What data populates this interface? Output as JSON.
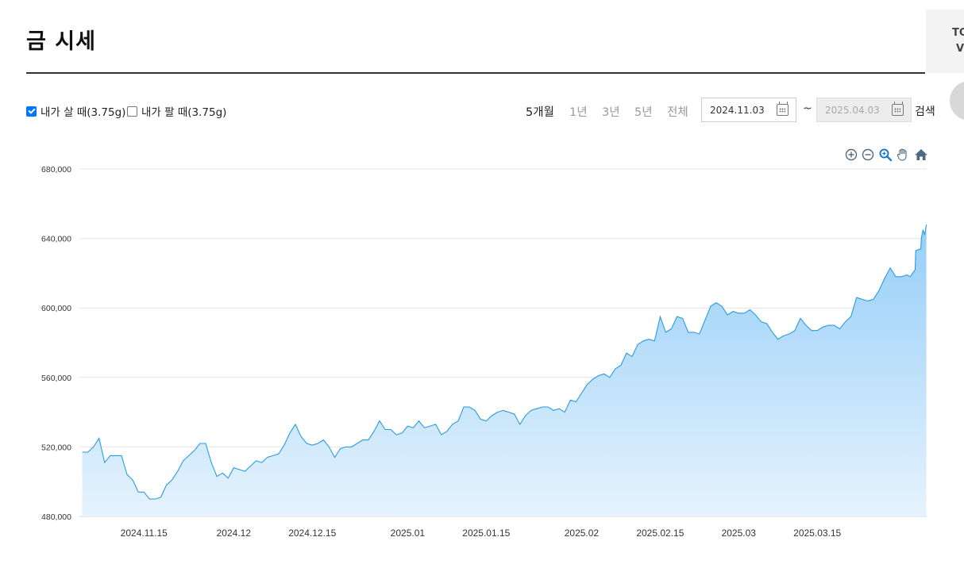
{
  "page": {
    "title": "금 시세",
    "side_box": [
      "TO",
      "V"
    ]
  },
  "filters": {
    "buy": {
      "label": "내가 살 때(3.75g)",
      "checked": true
    },
    "sell": {
      "label": "내가 팔 때(3.75g)",
      "checked": false
    }
  },
  "periods": [
    "5개월",
    "1년",
    "3년",
    "5년",
    "전체"
  ],
  "active_period": "5개월",
  "date_range": {
    "start": "2024.11.03",
    "end": "2025.04.03",
    "separator": "~"
  },
  "search_label": "검색",
  "toolbar": [
    "zoom-in-icon",
    "zoom-out-icon",
    "magnify-icon",
    "pan-hand-icon",
    "home-icon"
  ],
  "colors": {
    "line": "#2b9be0",
    "fill_top": "#95cef8",
    "fill_bottom": "#e6f3fd",
    "checkbox": "#0075ff"
  },
  "chart_data": {
    "type": "area",
    "x_labels": [
      "2024.11.15",
      "2024.12",
      "2024.12.15",
      "2025.01",
      "2025.01.15",
      "2025.02",
      "2025.02.15",
      "2025.03",
      "2025.03.15"
    ],
    "y_ticks": [
      "680,000",
      "640,000",
      "600,000",
      "560,000",
      "520,000",
      "480,000"
    ],
    "ylim": [
      480000,
      680000
    ],
    "xlim": [
      "2024-11-04",
      "2025-04-03"
    ],
    "grid": true,
    "series": [
      {
        "values": [
          [
            "2024-11-04",
            517000
          ],
          [
            "2024-11-05",
            517000
          ],
          [
            "2024-11-06",
            520000
          ],
          [
            "2024-11-07",
            525000
          ],
          [
            "2024-11-08",
            511000
          ],
          [
            "2024-11-09",
            515000
          ],
          [
            "2024-11-10",
            515000
          ],
          [
            "2024-11-11",
            515000
          ],
          [
            "2024-11-12",
            504000
          ],
          [
            "2024-11-13",
            501000
          ],
          [
            "2024-11-14",
            494000
          ],
          [
            "2024-11-15",
            494000
          ],
          [
            "2024-11-16",
            490000
          ],
          [
            "2024-11-17",
            490000
          ],
          [
            "2024-11-18",
            491000
          ],
          [
            "2024-11-19",
            498000
          ],
          [
            "2024-11-20",
            501000
          ],
          [
            "2024-11-21",
            506000
          ],
          [
            "2024-11-22",
            512000
          ],
          [
            "2024-11-23",
            515000
          ],
          [
            "2024-11-24",
            518000
          ],
          [
            "2024-11-25",
            522000
          ],
          [
            "2024-11-26",
            522000
          ],
          [
            "2024-11-27",
            511000
          ],
          [
            "2024-11-28",
            503000
          ],
          [
            "2024-11-29",
            505000
          ],
          [
            "2024-11-30",
            502000
          ],
          [
            "2024-12-01",
            508000
          ],
          [
            "2024-12-02",
            507000
          ],
          [
            "2024-12-03",
            506000
          ],
          [
            "2024-12-04",
            509000
          ],
          [
            "2024-12-05",
            512000
          ],
          [
            "2024-12-06",
            511000
          ],
          [
            "2024-12-07",
            514000
          ],
          [
            "2024-12-08",
            515000
          ],
          [
            "2024-12-09",
            516000
          ],
          [
            "2024-12-10",
            521000
          ],
          [
            "2024-12-11",
            528000
          ],
          [
            "2024-12-12",
            533000
          ],
          [
            "2024-12-13",
            526000
          ],
          [
            "2024-12-14",
            522000
          ],
          [
            "2024-12-15",
            521000
          ],
          [
            "2024-12-16",
            522000
          ],
          [
            "2024-12-17",
            524000
          ],
          [
            "2024-12-18",
            520000
          ],
          [
            "2024-12-19",
            514000
          ],
          [
            "2024-12-20",
            519000
          ],
          [
            "2024-12-21",
            520000
          ],
          [
            "2024-12-22",
            520000
          ],
          [
            "2024-12-23",
            522000
          ],
          [
            "2024-12-24",
            524000
          ],
          [
            "2024-12-25",
            524000
          ],
          [
            "2024-12-26",
            529000
          ],
          [
            "2024-12-27",
            535000
          ],
          [
            "2024-12-28",
            530000
          ],
          [
            "2024-12-29",
            530000
          ],
          [
            "2024-12-30",
            527000
          ],
          [
            "2024-12-31",
            528000
          ],
          [
            "2025-01-01",
            532000
          ],
          [
            "2025-01-02",
            531000
          ],
          [
            "2025-01-03",
            535000
          ],
          [
            "2025-01-04",
            531000
          ],
          [
            "2025-01-05",
            532000
          ],
          [
            "2025-01-06",
            533000
          ],
          [
            "2025-01-07",
            527000
          ],
          [
            "2025-01-08",
            529000
          ],
          [
            "2025-01-09",
            533000
          ],
          [
            "2025-01-10",
            535000
          ],
          [
            "2025-01-11",
            543000
          ],
          [
            "2025-01-12",
            543000
          ],
          [
            "2025-01-13",
            541000
          ],
          [
            "2025-01-14",
            536000
          ],
          [
            "2025-01-15",
            535000
          ],
          [
            "2025-01-16",
            538000
          ],
          [
            "2025-01-17",
            540000
          ],
          [
            "2025-01-18",
            541000
          ],
          [
            "2025-01-19",
            540000
          ],
          [
            "2025-01-20",
            539000
          ],
          [
            "2025-01-21",
            533000
          ],
          [
            "2025-01-22",
            538000
          ],
          [
            "2025-01-23",
            541000
          ],
          [
            "2025-01-24",
            542000
          ],
          [
            "2025-01-25",
            543000
          ],
          [
            "2025-01-26",
            543000
          ],
          [
            "2025-01-27",
            541000
          ],
          [
            "2025-01-28",
            542000
          ],
          [
            "2025-01-29",
            540000
          ],
          [
            "2025-01-30",
            547000
          ],
          [
            "2025-01-31",
            546000
          ],
          [
            "2025-02-01",
            551000
          ],
          [
            "2025-02-02",
            556000
          ],
          [
            "2025-02-03",
            559000
          ],
          [
            "2025-02-04",
            561000
          ],
          [
            "2025-02-05",
            562000
          ],
          [
            "2025-02-06",
            560000
          ],
          [
            "2025-02-07",
            565000
          ],
          [
            "2025-02-08",
            567000
          ],
          [
            "2025-02-09",
            574000
          ],
          [
            "2025-02-10",
            572000
          ],
          [
            "2025-02-11",
            579000
          ],
          [
            "2025-02-12",
            581000
          ],
          [
            "2025-02-13",
            582000
          ],
          [
            "2025-02-14",
            581000
          ],
          [
            "2025-02-15",
            595000
          ],
          [
            "2025-02-16",
            586000
          ],
          [
            "2025-02-17",
            588000
          ],
          [
            "2025-02-18",
            595000
          ],
          [
            "2025-02-19",
            594000
          ],
          [
            "2025-02-20",
            586000
          ],
          [
            "2025-02-21",
            586000
          ],
          [
            "2025-02-22",
            585000
          ],
          [
            "2025-02-23",
            593000
          ],
          [
            "2025-02-24",
            601000
          ],
          [
            "2025-02-25",
            603000
          ],
          [
            "2025-02-26",
            601000
          ],
          [
            "2025-02-27",
            596000
          ],
          [
            "2025-02-28",
            598000
          ],
          [
            "2025-03-01",
            597000
          ],
          [
            "2025-03-02",
            597000
          ],
          [
            "2025-03-03",
            599000
          ],
          [
            "2025-03-04",
            596000
          ],
          [
            "2025-03-05",
            592000
          ],
          [
            "2025-03-06",
            591000
          ],
          [
            "2025-03-07",
            586000
          ],
          [
            "2025-03-08",
            582000
          ],
          [
            "2025-03-09",
            584000
          ],
          [
            "2025-03-10",
            585000
          ],
          [
            "2025-03-11",
            587000
          ],
          [
            "2025-03-12",
            594000
          ],
          [
            "2025-03-13",
            590000
          ],
          [
            "2025-03-14",
            587000
          ],
          [
            "2025-03-15",
            587000
          ],
          [
            "2025-03-16",
            589000
          ],
          [
            "2025-03-17",
            590000
          ],
          [
            "2025-03-18",
            590000
          ],
          [
            "2025-03-19",
            588000
          ],
          [
            "2025-03-20",
            592000
          ],
          [
            "2025-03-21",
            595000
          ],
          [
            "2025-03-22",
            606000
          ],
          [
            "2025-03-23",
            605000
          ],
          [
            "2025-03-24",
            604000
          ],
          [
            "2025-03-25",
            605000
          ],
          [
            "2025-03-26",
            610000
          ],
          [
            "2025-03-27",
            617000
          ],
          [
            "2025-03-28",
            623000
          ],
          [
            "2025-03-29",
            618000
          ],
          [
            "2025-03-30",
            618000
          ],
          [
            "2025-03-31",
            619000
          ],
          [
            "2025-04-01",
            618000
          ],
          [
            "2025-04-01",
            622000
          ],
          [
            "2025-04-02",
            633000
          ],
          [
            "2025-04-02",
            634000
          ],
          [
            "2025-04-03",
            640000
          ],
          [
            "2025-04-03",
            645000
          ],
          [
            "2025-04-03",
            642000
          ],
          [
            "2025-04-03",
            648000
          ]
        ]
      }
    ]
  }
}
